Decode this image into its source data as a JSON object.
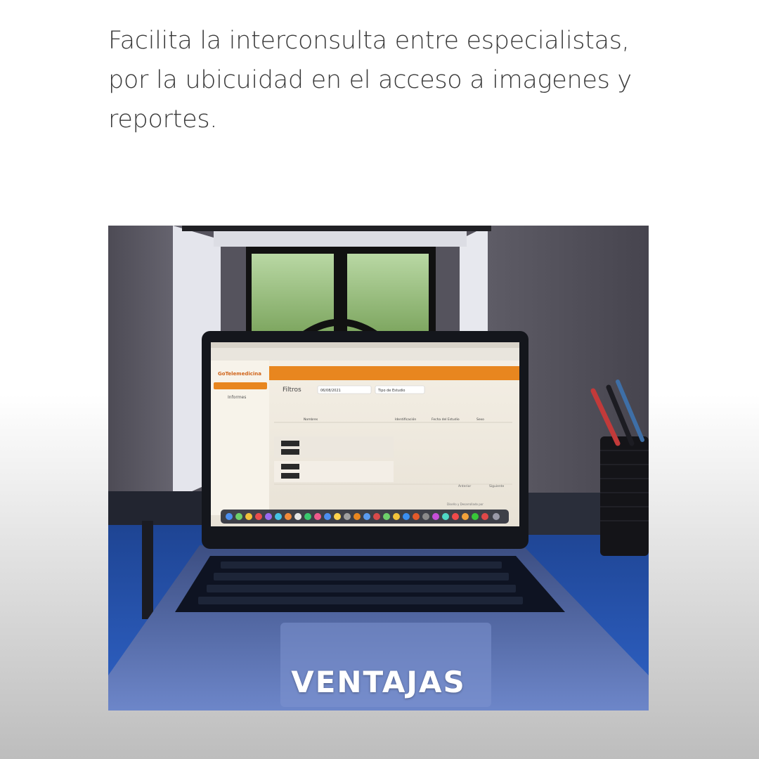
{
  "headline": "Facilita la interconsulta entre especialistas, por la ubicuidad en el acceso a imagenes y reportes.",
  "caption": "VENTAJAS",
  "laptop_screen": {
    "brand": "GoTelemedicina",
    "sidebar_item": "Informes",
    "filters_title": "Filtros",
    "date_value": "06/08/2021",
    "study_type": "Tipo de Estudio",
    "columns": [
      "Nombres",
      "Identificación",
      "Fecha del Estudio",
      "Sexo"
    ],
    "footer_brand": "Diseño y Desarrollado por",
    "pager_next": "Siguiente",
    "pager_prev": "Anterior"
  },
  "colors": {
    "brand_orange": "#e8861f",
    "caption_text": "#ffffff",
    "headline_text": "#3a3a3a"
  }
}
